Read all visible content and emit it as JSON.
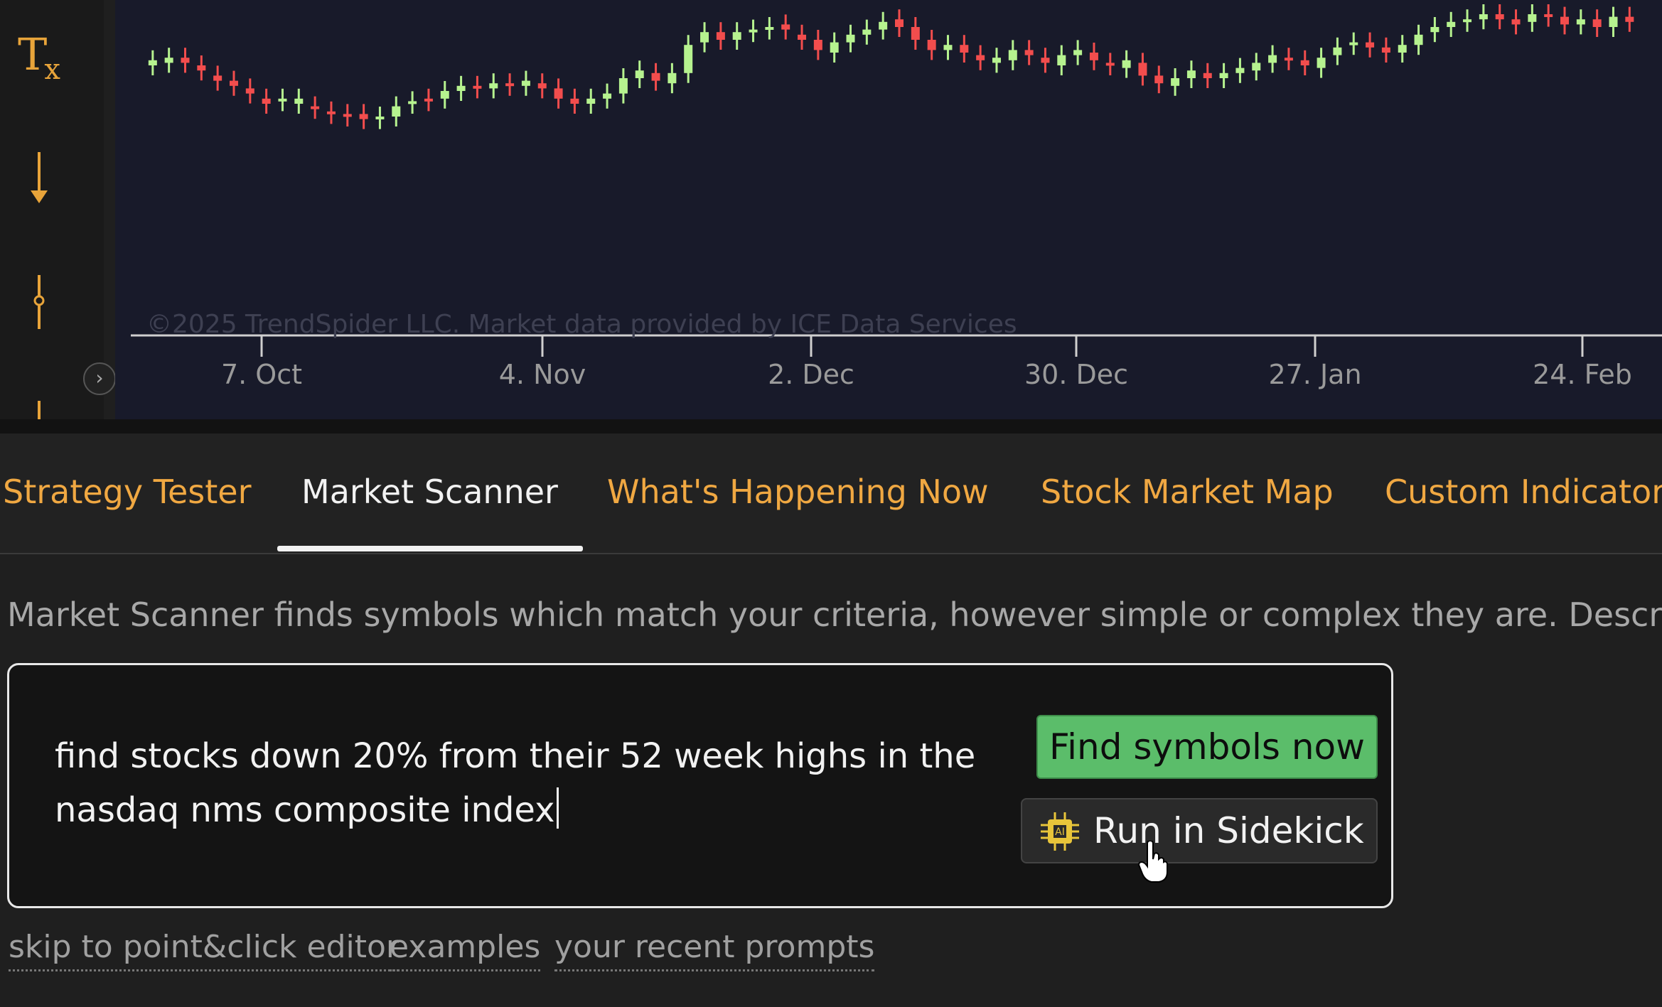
{
  "toolbar": {
    "icons": [
      "clear-format-icon",
      "arrow-down-icon",
      "pin-icon"
    ],
    "clear_label_main": "T",
    "clear_label_sub": "x"
  },
  "chart": {
    "watermark": "©2025 TrendSpider LLC. Market data provided by ICE Data Services",
    "x_labels": [
      "7. Oct",
      "4. Nov",
      "2. Dec",
      "30. Dec",
      "27. Jan",
      "24. Feb"
    ],
    "colors": {
      "up": "#b6f28f",
      "down": "#f24d4d",
      "background": "#181a2a",
      "axis": "#9a9a9a"
    }
  },
  "chart_data": {
    "type": "candlestick",
    "x_ticks": [
      "7. Oct",
      "4. Nov",
      "2. Dec",
      "30. Dec",
      "27. Jan",
      "24. Feb"
    ],
    "candles": [
      [
        0.2,
        0.18
      ],
      [
        0.19,
        0.17
      ],
      [
        0.17,
        0.19
      ],
      [
        0.2,
        0.22
      ],
      [
        0.24,
        0.26
      ],
      [
        0.26,
        0.28
      ],
      [
        0.29,
        0.31
      ],
      [
        0.33,
        0.35
      ],
      [
        0.34,
        0.33
      ],
      [
        0.35,
        0.33
      ],
      [
        0.36,
        0.37
      ],
      [
        0.38,
        0.39
      ],
      [
        0.39,
        0.4
      ],
      [
        0.39,
        0.41
      ],
      [
        0.41,
        0.4
      ],
      [
        0.4,
        0.36
      ],
      [
        0.35,
        0.34
      ],
      [
        0.33,
        0.34
      ],
      [
        0.33,
        0.3
      ],
      [
        0.3,
        0.28
      ],
      [
        0.28,
        0.29
      ],
      [
        0.29,
        0.27
      ],
      [
        0.27,
        0.28
      ],
      [
        0.28,
        0.26
      ],
      [
        0.27,
        0.29
      ],
      [
        0.29,
        0.33
      ],
      [
        0.33,
        0.35
      ],
      [
        0.35,
        0.33
      ],
      [
        0.33,
        0.31
      ],
      [
        0.31,
        0.25
      ],
      [
        0.25,
        0.22
      ],
      [
        0.23,
        0.26
      ],
      [
        0.27,
        0.23
      ],
      [
        0.23,
        0.12
      ],
      [
        0.11,
        0.07
      ],
      [
        0.07,
        0.1
      ],
      [
        0.1,
        0.07
      ],
      [
        0.07,
        0.06
      ],
      [
        0.06,
        0.05
      ],
      [
        0.04,
        0.06
      ],
      [
        0.08,
        0.1
      ],
      [
        0.1,
        0.14
      ],
      [
        0.15,
        0.11
      ],
      [
        0.11,
        0.08
      ],
      [
        0.08,
        0.06
      ],
      [
        0.06,
        0.03
      ],
      [
        0.02,
        0.05
      ],
      [
        0.05,
        0.1
      ],
      [
        0.1,
        0.14
      ],
      [
        0.14,
        0.12
      ],
      [
        0.12,
        0.15
      ],
      [
        0.16,
        0.18
      ],
      [
        0.19,
        0.17
      ],
      [
        0.18,
        0.14
      ],
      [
        0.14,
        0.16
      ],
      [
        0.17,
        0.19
      ],
      [
        0.2,
        0.16
      ],
      [
        0.16,
        0.14
      ],
      [
        0.15,
        0.18
      ],
      [
        0.19,
        0.2
      ],
      [
        0.21,
        0.18
      ],
      [
        0.19,
        0.24
      ],
      [
        0.24,
        0.27
      ],
      [
        0.28,
        0.25
      ],
      [
        0.25,
        0.22
      ],
      [
        0.23,
        0.25
      ],
      [
        0.25,
        0.23
      ],
      [
        0.23,
        0.21
      ],
      [
        0.22,
        0.19
      ],
      [
        0.19,
        0.16
      ],
      [
        0.17,
        0.18
      ],
      [
        0.18,
        0.2
      ],
      [
        0.21,
        0.17
      ],
      [
        0.16,
        0.13
      ],
      [
        0.12,
        0.11
      ],
      [
        0.11,
        0.13
      ],
      [
        0.13,
        0.15
      ],
      [
        0.15,
        0.12
      ],
      [
        0.12,
        0.08
      ],
      [
        0.07,
        0.05
      ],
      [
        0.05,
        0.03
      ],
      [
        0.03,
        0.02
      ],
      [
        0.02,
        0.0
      ],
      [
        0.0,
        0.02
      ],
      [
        0.02,
        0.04
      ],
      [
        0.03,
        0.0
      ],
      [
        0.0,
        0.01
      ],
      [
        0.01,
        0.04
      ],
      [
        0.04,
        0.02
      ],
      [
        0.02,
        0.05
      ],
      [
        0.05,
        0.01
      ],
      [
        0.01,
        0.03
      ]
    ]
  },
  "tabs": [
    {
      "label": "Strategy Tester",
      "active": false
    },
    {
      "label": "Market Scanner",
      "active": true
    },
    {
      "label": "What's Happening Now",
      "active": false
    },
    {
      "label": "Stock Market Map",
      "active": false
    },
    {
      "label": "Custom Indicator",
      "active": false
    }
  ],
  "scanner": {
    "description": "Market Scanner finds symbols which match your criteria, however simple or complex they are. Describe",
    "prompt_line1": "find stocks down 20% from their 52 week highs in the",
    "prompt_line2": "nasdaq nms composite index",
    "find_button": "Find symbols now",
    "sidekick_button": "Run in Sidekick",
    "find_button_color": "#5bbd6a"
  },
  "links": {
    "editor": "skip to point&click editor",
    "examples": "examples",
    "recent": "your recent prompts"
  }
}
